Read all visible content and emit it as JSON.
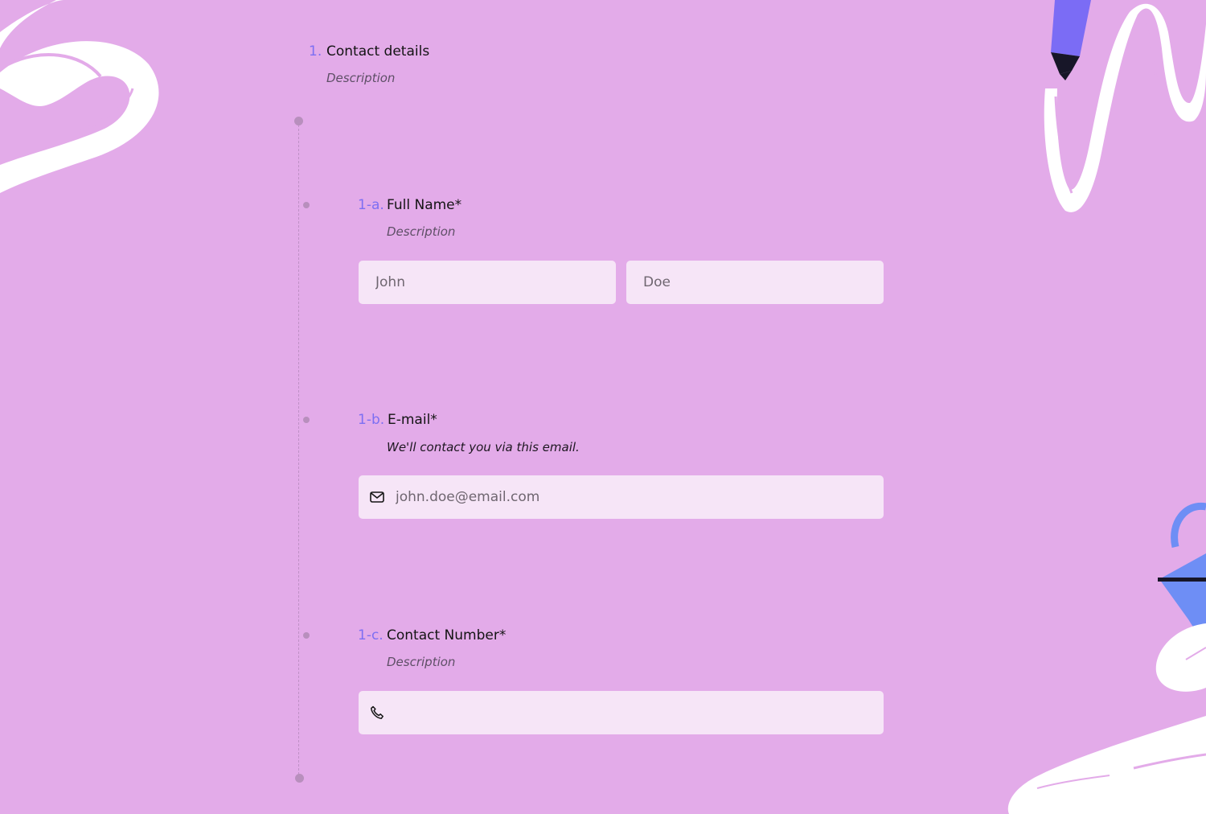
{
  "section": {
    "number": "1.",
    "title": "Contact details",
    "description": "Description"
  },
  "questions": [
    {
      "number": "1-a.",
      "title": "Full Name*",
      "description": "Description",
      "fields": [
        {
          "placeholder": "John"
        },
        {
          "placeholder": "Doe"
        }
      ]
    },
    {
      "number": "1-b.",
      "title": "E-mail*",
      "description": "We'll contact you via this email.",
      "fields": [
        {
          "placeholder": "john.doe@email.com",
          "icon": "mail-icon"
        }
      ]
    },
    {
      "number": "1-c.",
      "title": "Contact Number*",
      "description": "Description",
      "fields": [
        {
          "placeholder": "",
          "icon": "phone-icon"
        }
      ]
    }
  ],
  "colors": {
    "background": "#e3abe9",
    "accent": "#7d6ff2",
    "field_background": "#f6e5f7"
  }
}
